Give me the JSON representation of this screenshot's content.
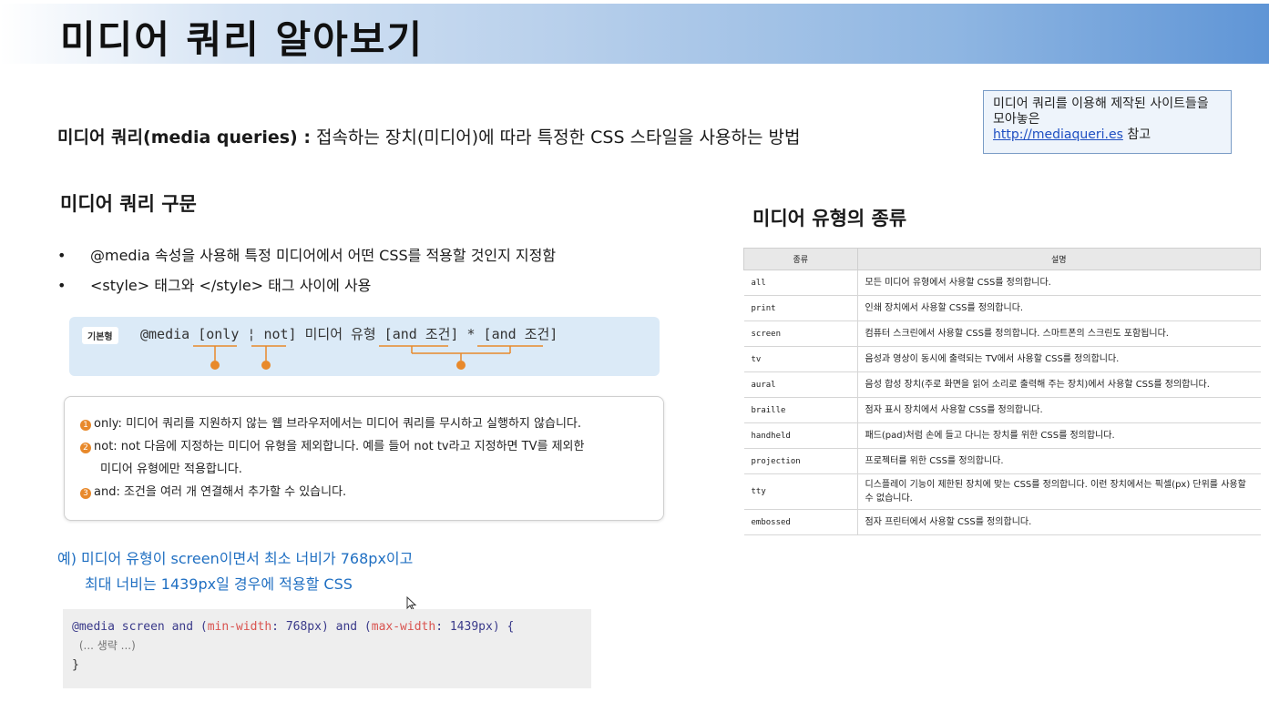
{
  "title": "미디어 쿼리 알아보기",
  "definition": {
    "term": "미디어 쿼리(media queries) :",
    "text": " 접속하는 장치(미디어)에 따라 특정한 CSS 스타일을 사용하는 방법"
  },
  "note": {
    "text": "미디어 쿼리를 이용해 제작된 사이트들을 모아놓은",
    "link": "http://mediaqueri.es",
    "suffix": " 참고"
  },
  "syntax_section": {
    "heading": "미디어 쿼리 구문",
    "bullets": [
      "@media 속성을 사용해 특정 미디어에서 어떤 CSS를 적용할 것인지 지정함",
      "<style> 태그와 </style> 태그 사이에 사용"
    ],
    "tag": "기본형",
    "code": "@media [only ¦ not] 미디어 유형 [and 조건] * [and 조건]",
    "markers": [
      "1",
      "2",
      "3"
    ],
    "explanations": {
      "only": "only: 미디어 쿼리를 지원하지 않는 웹 브라우저에서는 미디어 쿼리를 무시하고 실행하지 않습니다.",
      "not_line1": "not: not 다음에 지정하는 미디어 유형을 제외합니다. 예를 들어 not tv라고 지정하면 TV를 제외한",
      "not_line2": "미디어 유형에만 적용합니다.",
      "and": "and: 조건을 여러 개 연결해서 추가할 수 있습니다."
    }
  },
  "example": {
    "line1": "예) 미디어 유형이 screen이면서 최소 너비가 768px이고",
    "line2": "최대 너비는 1439px일 경우에 적용할 CSS",
    "code": {
      "at": "@media screen and (",
      "prop1": "min-width",
      "v1": ": 768px) and (",
      "prop2": "max-width",
      "v2": ": 1439px) {",
      "comment": "(... 생략 ...)",
      "close": "}"
    }
  },
  "types_section": {
    "heading": "미디어 유형의 종류",
    "columns": [
      "종류",
      "설명"
    ],
    "rows": [
      {
        "type": "all",
        "desc": "모든 미디어 유형에서 사용할 CSS를 정의합니다."
      },
      {
        "type": "print",
        "desc": "인쇄 장치에서 사용할 CSS를 정의합니다."
      },
      {
        "type": "screen",
        "desc": "컴퓨터 스크린에서 사용할 CSS를 정의합니다. 스마트폰의 스크린도 포함됩니다."
      },
      {
        "type": "tv",
        "desc": "음성과 영상이 동시에 출력되는 TV에서 사용할 CSS를 정의합니다."
      },
      {
        "type": "aural",
        "desc": "음성 합성 장치(주로 화면을 읽어 소리로 출력해 주는 장치)에서 사용할 CSS를 정의합니다."
      },
      {
        "type": "braille",
        "desc": "점자 표시 장치에서 사용할 CSS를 정의합니다."
      },
      {
        "type": "handheld",
        "desc": "패드(pad)처럼 손에 들고 다니는 장치를 위한 CSS를 정의합니다."
      },
      {
        "type": "projection",
        "desc": "프로젝터를 위한 CSS를 정의합니다."
      },
      {
        "type": "tty",
        "desc": "디스플레이 기능이 제한된 장치에 맞는 CSS를 정의합니다. 이런 장치에서는 픽셀(px) 단위를 사용할 수 없습니다."
      },
      {
        "type": "embossed",
        "desc": "점자 프린터에서 사용할 CSS를 정의합니다."
      }
    ]
  },
  "colors": {
    "accent_orange": "#e8892b",
    "link_blue": "#1f6fc2"
  }
}
